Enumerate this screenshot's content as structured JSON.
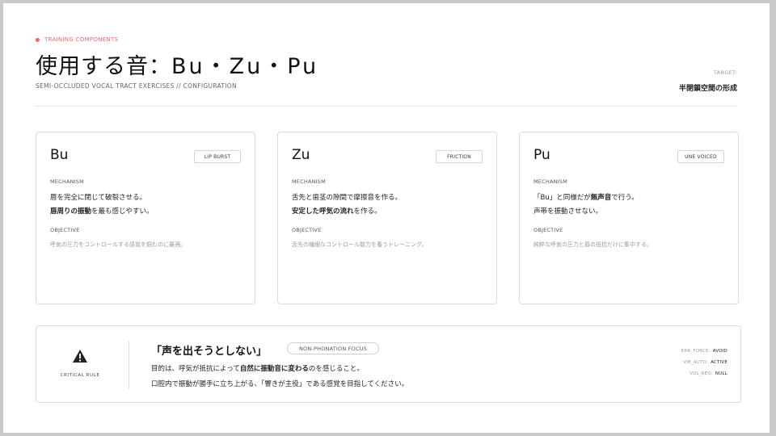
{
  "header": {
    "eyebrow": "TRAINING  COMPONENTS",
    "title_jp": "使用する音：",
    "title_latin": "Bu・Zu・Pu",
    "subtitle": "SEMI-OCCLUDED  VOCAL  TRACT  EXERCISES  //  CONFIGURATION",
    "target_label": "TARGET:",
    "target_value": "半閉鎖空間の形成"
  },
  "cards": [
    {
      "title": "Bu",
      "tag": "LIP BURST",
      "mechanism_label": "MECHANISM",
      "line1": "唇を完全に閉じて破裂させる。",
      "line2_bold": "唇周りの振動",
      "line2_rest": "を最も感じやすい。",
      "objective_label": "OBJECTIVE",
      "objective": "呼気の圧力をコントロールする感覚を掴むのに最適。"
    },
    {
      "title": "Zu",
      "tag": "FRICTION",
      "mechanism_label": "MECHANISM",
      "line1": "舌先と歯茎の隙間で摩擦音を作る。",
      "line2_bold": "安定した呼気の流れ",
      "line2_rest": "を作る。",
      "objective_label": "OBJECTIVE",
      "objective": "舌先の繊細なコントロール能力を養うトレーニング。"
    },
    {
      "title": "Pu",
      "tag": "UNE VOICED",
      "mechanism_label": "MECHANISM",
      "line1_pre": "「Bu」と同様だが",
      "line1_bold": "無声音",
      "line1_post": "で行う。",
      "line2": "声帯を振動させない。",
      "objective_label": "OBJECTIVE",
      "objective": "純粋な呼気の圧力と唇の抵抗だけに集中する。"
    }
  ],
  "rule": {
    "critical_label": "CRITICAL  RULE",
    "quote": "「声を出そうとしない」",
    "focus_tag": "NON-PHONATION  FOCUS",
    "desc1_pre": "目的は、呼気が抵抗によって",
    "desc1_bold": "自然に振動音に変わる",
    "desc1_post": "のを感じること。",
    "desc2": "口腔内で振動が勝手に立ち上がる、「響きが主役」である感覚を目指してください。",
    "status": [
      {
        "key": "ERR_FORCE:",
        "value": "AVOID"
      },
      {
        "key": "VIB_AUTO:",
        "value": "ACTIVE"
      },
      {
        "key": "VOL_REQ:",
        "value": "NULL"
      }
    ]
  },
  "colors": {
    "accent": "#e36b6b"
  }
}
